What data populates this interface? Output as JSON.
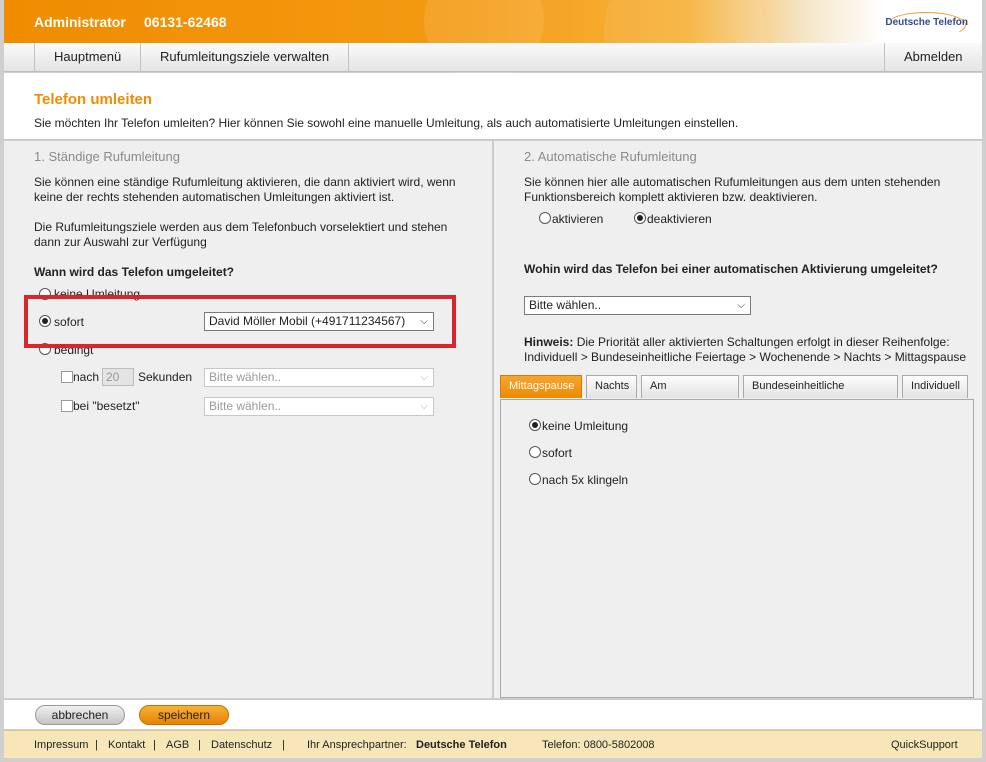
{
  "header": {
    "user": "Administrator",
    "phone": "06131-62468",
    "logo_text": "Deutsche Telefon"
  },
  "nav": {
    "main_menu": "Hauptmenü",
    "manage_targets": "Rufumleitungsziele verwalten",
    "logout": "Abmelden"
  },
  "intro": {
    "title": "Telefon umleiten",
    "text": "Sie möchten Ihr Telefon umleiten? Hier können Sie sowohl eine manuelle Umleitung, als auch automatisierte Umleitungen einstellen."
  },
  "left": {
    "title": "1. Ständige Rufumleitung",
    "text1a": "Sie können eine ständige Rufumleitung aktivieren, die dann aktiviert wird, wenn",
    "text1b": "keine der rechts stehenden automatischen Umleitungen aktiviert ist.",
    "text2a": "Die Rufumleitungsziele werden aus dem Telefonbuch vorselektiert und stehen",
    "text2b": "dann zur Auswahl zur Verfügung",
    "question": "Wann wird das Telefon umgeleitet?",
    "opt_none": "keine Umleitung",
    "opt_immediate": "sofort",
    "immediate_target": "David Möller Mobil (+491711234567)",
    "opt_conditional": "bedingt",
    "after_label": "nach",
    "after_value": "20",
    "seconds_label": "Sekunden",
    "after_target": "Bitte wählen..",
    "busy_label": "bei \"besetzt\"",
    "busy_target": "Bitte wählen.."
  },
  "right": {
    "title": "2. Automatische Rufumleitung",
    "text1a": "Sie können hier alle automatischen Rufumleitungen aus dem unten stehenden",
    "text1b": "Funktionsbereich komplett aktivieren bzw. deaktivieren.",
    "activate": "aktivieren",
    "deactivate": "deaktivieren",
    "question": "Wohin wird das Telefon bei einer automatischen Aktivierung umgeleitet?",
    "target": "Bitte wählen..",
    "hint_label": "Hinweis:",
    "hint_text": "Die Priorität aller aktivierten Schaltungen erfolgt in dieser Reihenfolge:",
    "hint_order": "Individuell > Bundeseinheitliche Feiertage > Wochenende > Nachts > Mittagspause",
    "tabs": [
      "Mittagspause",
      "Nachts",
      "Am Wochenende",
      "Bundeseinheitliche Feiertage",
      "Individuell"
    ],
    "tab_opt_none": "keine Umleitung",
    "tab_opt_immediate": "sofort",
    "tab_opt_ring": "nach 5x klingeln"
  },
  "buttons": {
    "cancel": "abbrechen",
    "save": "speichern"
  },
  "footer": {
    "imprint": "Impressum",
    "contact": "Kontakt",
    "terms": "AGB",
    "privacy": "Datenschutz",
    "partner_label": "Ihr Ansprechpartner:",
    "partner_name": "Deutsche Telefon",
    "phone": "Telefon: 0800-5802008",
    "support": "QuickSupport",
    "sep": "|"
  },
  "colors": {
    "brand_orange": "#f08c00",
    "highlight_red": "#d9262c"
  }
}
